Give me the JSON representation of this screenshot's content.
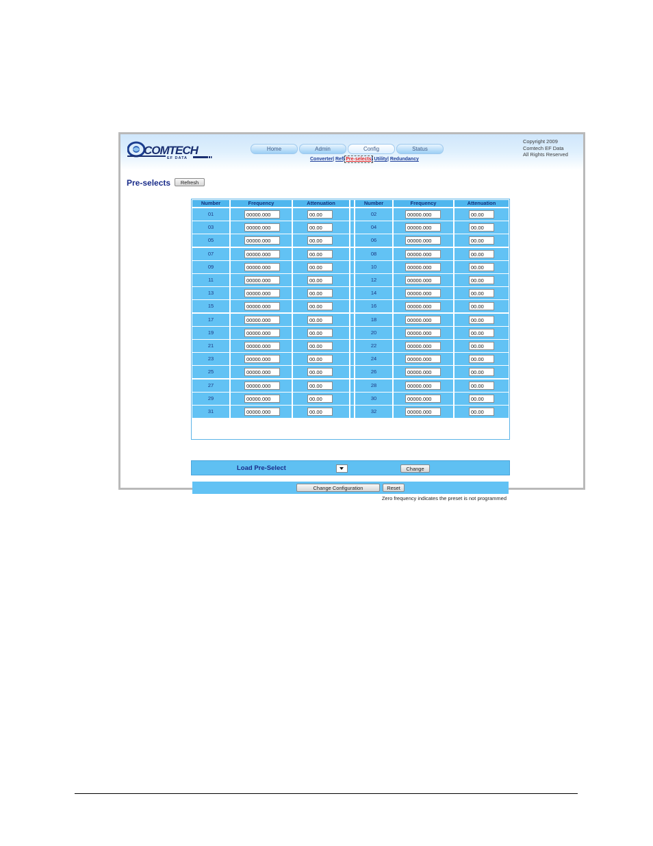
{
  "header": {
    "logo_text": "COMTECH",
    "logo_sub": "EF DATA",
    "copyright_lines": [
      "Copyright 2009",
      "Comtech EF Data",
      "All Rights Reserved"
    ]
  },
  "nav": {
    "tabs": [
      {
        "label": "Home",
        "active": false
      },
      {
        "label": "Admin",
        "active": false
      },
      {
        "label": "Config",
        "active": true
      },
      {
        "label": "Status",
        "active": false
      }
    ],
    "subnav": [
      {
        "label": "Converter",
        "active": false
      },
      {
        "label": "Ref",
        "active": false
      },
      {
        "label": "Pre-selects",
        "active": true
      },
      {
        "label": "Utility",
        "active": false
      },
      {
        "label": "Redundancy",
        "active": false
      }
    ]
  },
  "page": {
    "title": "Pre-selects",
    "refresh_label": "Refresh"
  },
  "table": {
    "headers": [
      "Number",
      "Frequency",
      "Attenuation",
      "Number",
      "Frequency",
      "Attenuation"
    ],
    "rows": [
      {
        "left": {
          "number": "01",
          "frequency": "00000.000",
          "attenuation": "00.00"
        },
        "right": {
          "number": "02",
          "frequency": "00000.000",
          "attenuation": "00.00"
        }
      },
      {
        "left": {
          "number": "03",
          "frequency": "00000.000",
          "attenuation": "00.00"
        },
        "right": {
          "number": "04",
          "frequency": "00000.000",
          "attenuation": "00.00"
        }
      },
      {
        "left": {
          "number": "05",
          "frequency": "00000.000",
          "attenuation": "00.00"
        },
        "right": {
          "number": "06",
          "frequency": "00000.000",
          "attenuation": "00.00"
        }
      },
      {
        "left": {
          "number": "07",
          "frequency": "00000.000",
          "attenuation": "00.00"
        },
        "right": {
          "number": "08",
          "frequency": "00000.000",
          "attenuation": "00.00"
        }
      },
      {
        "left": {
          "number": "09",
          "frequency": "00000.000",
          "attenuation": "00.00"
        },
        "right": {
          "number": "10",
          "frequency": "00000.000",
          "attenuation": "00.00"
        }
      },
      {
        "left": {
          "number": "11",
          "frequency": "00000.000",
          "attenuation": "00.00"
        },
        "right": {
          "number": "12",
          "frequency": "00000.000",
          "attenuation": "00.00"
        }
      },
      {
        "left": {
          "number": "13",
          "frequency": "00000.000",
          "attenuation": "00.00"
        },
        "right": {
          "number": "14",
          "frequency": "00000.000",
          "attenuation": "00.00"
        }
      },
      {
        "left": {
          "number": "15",
          "frequency": "00000.000",
          "attenuation": "00.00"
        },
        "right": {
          "number": "16",
          "frequency": "00000.000",
          "attenuation": "00.00"
        }
      },
      {
        "left": {
          "number": "17",
          "frequency": "00000.000",
          "attenuation": "00.00"
        },
        "right": {
          "number": "18",
          "frequency": "00000.000",
          "attenuation": "00.00"
        }
      },
      {
        "left": {
          "number": "19",
          "frequency": "00000.000",
          "attenuation": "00.00"
        },
        "right": {
          "number": "20",
          "frequency": "00000.000",
          "attenuation": "00.00"
        }
      },
      {
        "left": {
          "number": "21",
          "frequency": "00000.000",
          "attenuation": "00.00"
        },
        "right": {
          "number": "22",
          "frequency": "00000.000",
          "attenuation": "00.00"
        }
      },
      {
        "left": {
          "number": "23",
          "frequency": "00000.000",
          "attenuation": "00.00"
        },
        "right": {
          "number": "24",
          "frequency": "00000.000",
          "attenuation": "00.00"
        }
      },
      {
        "left": {
          "number": "25",
          "frequency": "00000.000",
          "attenuation": "00.00"
        },
        "right": {
          "number": "26",
          "frequency": "00000.000",
          "attenuation": "00.00"
        }
      },
      {
        "left": {
          "number": "27",
          "frequency": "00000.000",
          "attenuation": "00.00"
        },
        "right": {
          "number": "28",
          "frequency": "00000.000",
          "attenuation": "00.00"
        }
      },
      {
        "left": {
          "number": "29",
          "frequency": "00000.000",
          "attenuation": "00.00"
        },
        "right": {
          "number": "30",
          "frequency": "00000.000",
          "attenuation": "00.00"
        }
      },
      {
        "left": {
          "number": "31",
          "frequency": "00000.000",
          "attenuation": "00.00"
        },
        "right": {
          "number": "32",
          "frequency": "00000.000",
          "attenuation": "00.00"
        }
      }
    ],
    "change_config_label": "Change Configuration",
    "reset_label": "Reset",
    "note": "Zero frequency indicates the preset is not programmed"
  },
  "load_preselect": {
    "label": "Load Pre-Select",
    "selected": "",
    "change_label": "Change"
  },
  "colors": {
    "header_cell": "#4fb6ee",
    "row_cell": "#62c2f4",
    "title_text": "#1a2d8a",
    "link": "#1d3e9a",
    "active_link": "#e11c1c"
  }
}
